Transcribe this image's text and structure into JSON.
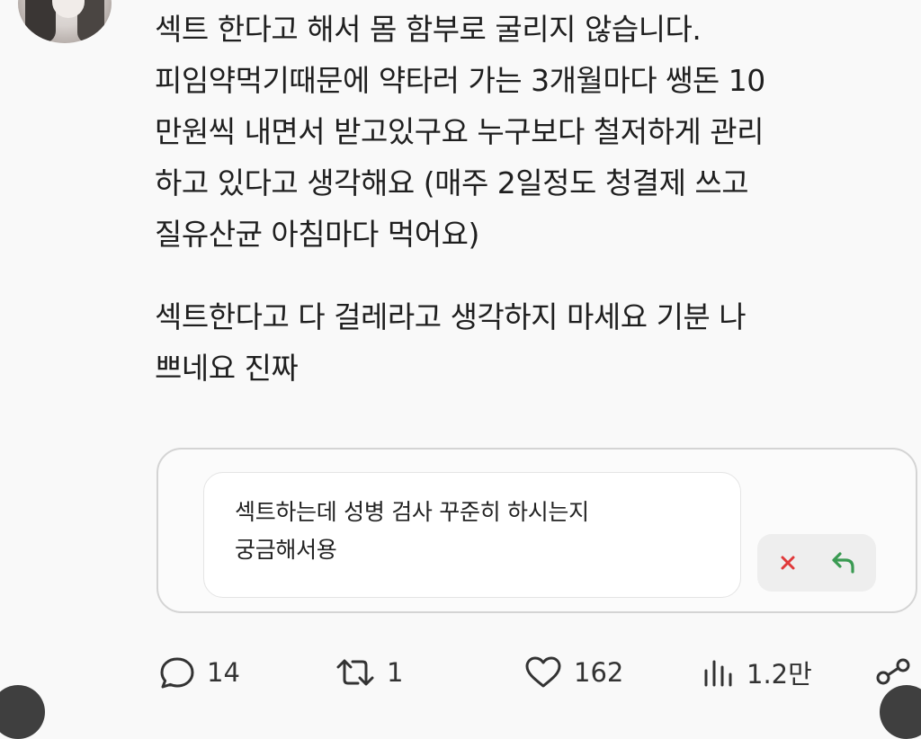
{
  "post": {
    "paragraphs": [
      "섹트 한다고 해서 몸 함부로 굴리지 않습니다.\n피임약먹기때문에 약타러 가는 3개월마다 쌩돈 10\n만원씩 내면서 받고있구요 누구보다 철저하게 관리\n하고 있다고 생각해요 (매주 2일정도 청결제 쓰고\n질유산균 아침마다 먹어요)",
      "섹트한다고 다 걸레라고 생각하지 마세요 기분 나\n쁘네요 진짜"
    ]
  },
  "quote": {
    "text": "섹트하는데 성병 검사 꾸준히 하시는지\n궁금해서용"
  },
  "actions": {
    "replies": "14",
    "reposts": "1",
    "likes": "162",
    "views": "1.2만"
  },
  "colors": {
    "background": "#f9f9f9",
    "reject": "#e0393a",
    "reply_arrow": "#3a9a52"
  },
  "icons": {
    "reply": "speech-bubble-icon",
    "repost": "repost-arrows-icon",
    "like": "heart-icon",
    "views": "bar-chart-icon",
    "share": "share-icon",
    "reject": "close-x-icon",
    "answer": "reply-arrow-icon"
  }
}
